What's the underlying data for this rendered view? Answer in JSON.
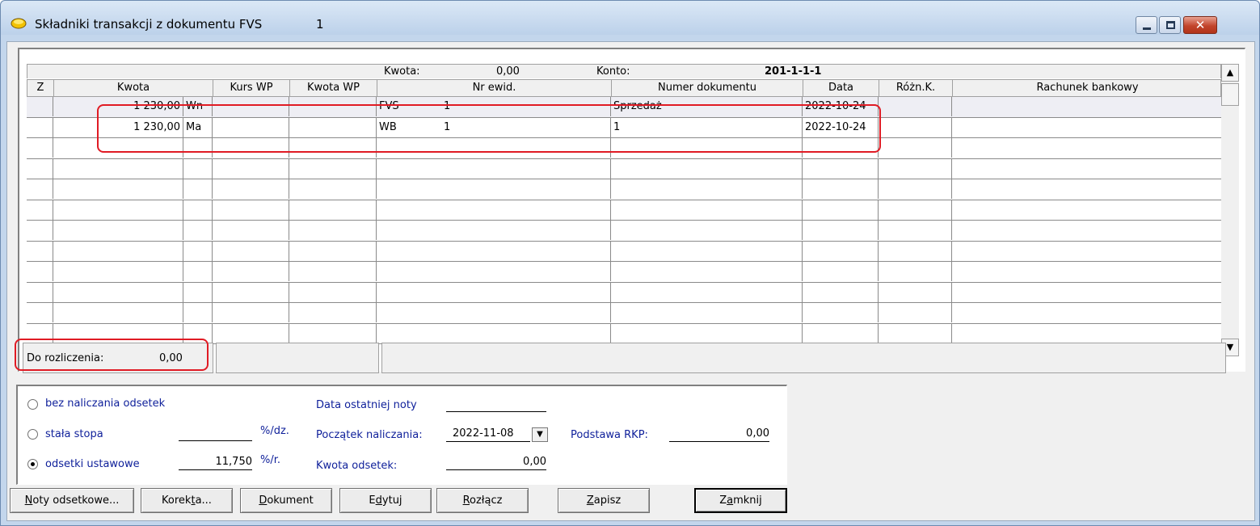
{
  "window": {
    "title": "Składniki transakcji z dokumentu FVS",
    "title_number": "1",
    "controls": {
      "minimize": "minimize-icon",
      "maximize": "maximize-icon",
      "close": "close-icon"
    }
  },
  "info": {
    "kwota_label": "Kwota:",
    "kwota_value": "0,00",
    "konto_label": "Konto:",
    "konto_value": "201-1-1-1"
  },
  "columns": [
    "Z",
    "Kwota",
    "Kurs WP",
    "Kwota WP",
    "Nr ewid.",
    "Numer dokumentu",
    "Data",
    "Różn.K.",
    "Rachunek bankowy"
  ],
  "rows": [
    {
      "z": "",
      "kwota": "1 230,00",
      "strona": "Wn",
      "kurs_wp": "",
      "kwota_wp": "",
      "nr_ewid_typ": "FVS",
      "nr_ewid_nr": "1",
      "numer_dokumentu": "Sprzedaż",
      "data": "2022-10-24",
      "rozn_k": "",
      "rachunek": ""
    },
    {
      "z": "",
      "kwota": "1 230,00",
      "strona": "Ma",
      "kurs_wp": "",
      "kwota_wp": "",
      "nr_ewid_typ": "WB",
      "nr_ewid_nr": "1",
      "numer_dokumentu": "1",
      "data": "2022-10-24",
      "rozn_k": "",
      "rachunek": ""
    }
  ],
  "footer": {
    "do_rozliczenia_label": "Do rozliczenia:",
    "do_rozliczenia_value": "0,00"
  },
  "options": {
    "bez_naliczania": "bez naliczania odsetek",
    "stala_stopa": "stała stopa",
    "stala_stopa_value": "",
    "stala_stopa_unit": "%/dz.",
    "odsetki_ustawowe": "odsetki ustawowe",
    "odsetki_value": "11,750",
    "odsetki_unit": "%/r.",
    "selected": "odsetki ustawowe",
    "data_ostatniej_noty_label": "Data ostatniej noty",
    "data_ostatniej_noty_value": "",
    "poczatek_label": "Początek naliczania:",
    "poczatek_value": "2022-11-08",
    "kwota_odsetek_label": "Kwota odsetek:",
    "kwota_odsetek_value": "0,00",
    "podstawa_label": "Podstawa RKP:",
    "podstawa_value": "0,00"
  },
  "buttons": {
    "noty_first": "N",
    "noty_rest": "oty odsetkowe...",
    "korekta_pre": "Korek",
    "korekta_u": "t",
    "korekta_post": "a...",
    "dokument_first": "D",
    "dokument_rest": "okument",
    "edytuj_pre": "E",
    "edytuj_u": "d",
    "edytuj_post": "ytuj",
    "rozlacz_first": "R",
    "rozlacz_rest": "ozłącz",
    "zapisz_first": "Z",
    "zapisz_rest": "apisz",
    "zamknij_pre": "Z",
    "zamknij_u": "a",
    "zamknij_post": "mknij"
  },
  "colors": {
    "highlight": "#e01b24",
    "label_blue": "#0e1f9a",
    "title_bar": "#c3d6ec"
  }
}
